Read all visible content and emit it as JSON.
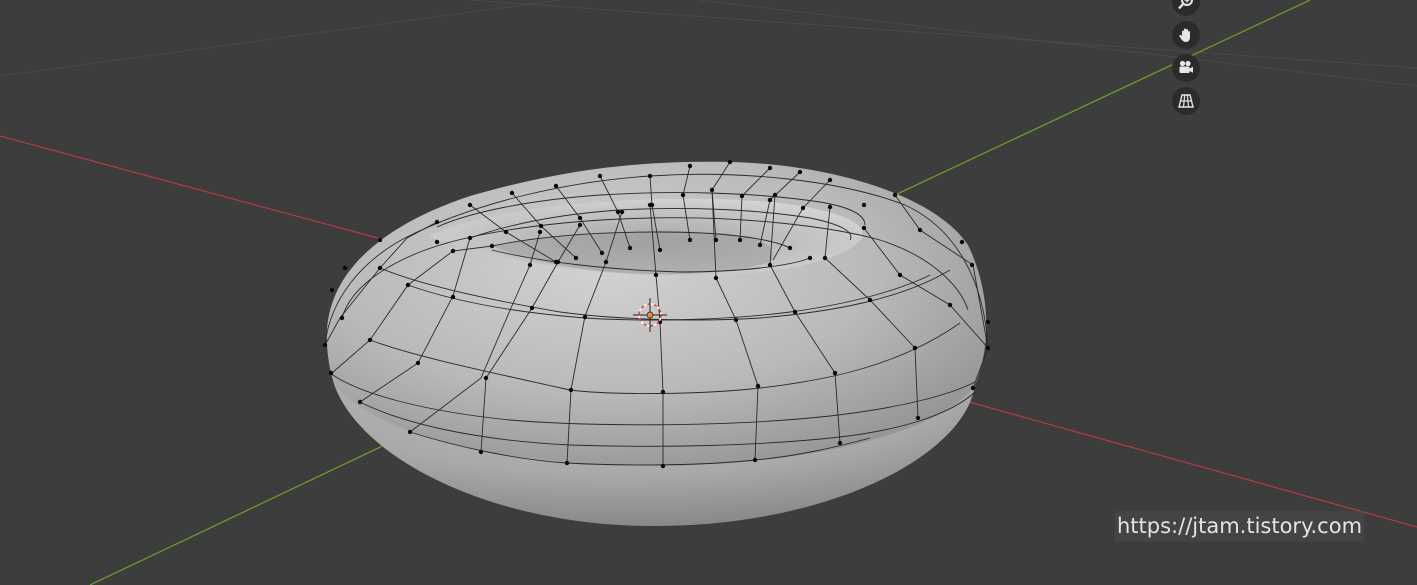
{
  "viewport": {
    "background": "#3d3d3d",
    "object": "torus",
    "mode": "edit-mode",
    "axis_colors": {
      "x": "#b23a45",
      "y": "#6d9a2e"
    }
  },
  "navigation": [
    {
      "name": "zoom-icon"
    },
    {
      "name": "hand-pan-icon"
    },
    {
      "name": "camera-icon"
    },
    {
      "name": "perspective-grid-icon"
    }
  ],
  "watermark": {
    "text": "https://jtam.tistory.com"
  }
}
